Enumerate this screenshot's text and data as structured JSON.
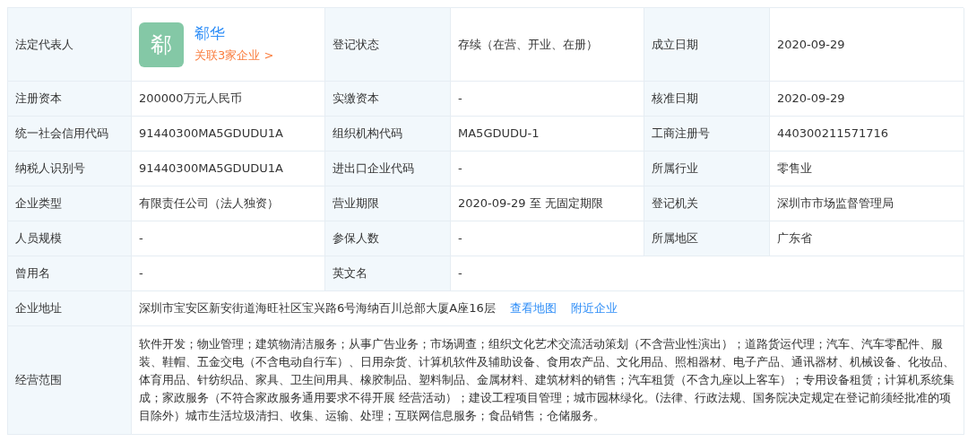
{
  "rows": [
    {
      "kind": "pairs",
      "items": [
        {
          "kind": "person",
          "label": "法定代表人",
          "avatar": "郗",
          "name": "郗华",
          "link": "关联3家企业 >"
        },
        {
          "kind": "text",
          "label": "登记状态",
          "value": "存续（在营、开业、在册）"
        },
        {
          "kind": "text",
          "label": "成立日期",
          "value": "2020-09-29"
        }
      ]
    },
    {
      "kind": "pairs",
      "items": [
        {
          "kind": "text",
          "label": "注册资本",
          "value": "200000万元人民币"
        },
        {
          "kind": "text",
          "label": "实缴资本",
          "value": "-"
        },
        {
          "kind": "text",
          "label": "核准日期",
          "value": "2020-09-29"
        }
      ]
    },
    {
      "kind": "pairs",
      "items": [
        {
          "kind": "text",
          "label": "统一社会信用代码",
          "value": "91440300MA5GDUDU1A"
        },
        {
          "kind": "text",
          "label": "组织机构代码",
          "value": "MA5GDUDU-1"
        },
        {
          "kind": "text",
          "label": "工商注册号",
          "value": "440300211571716"
        }
      ]
    },
    {
      "kind": "pairs",
      "items": [
        {
          "kind": "text",
          "label": "纳税人识别号",
          "value": "91440300MA5GDUDU1A"
        },
        {
          "kind": "text",
          "label": "进出口企业代码",
          "value": "-"
        },
        {
          "kind": "text",
          "label": "所属行业",
          "value": "零售业"
        }
      ]
    },
    {
      "kind": "pairs",
      "items": [
        {
          "kind": "text",
          "label": "企业类型",
          "value": "有限责任公司（法人独资）"
        },
        {
          "kind": "text",
          "label": "营业期限",
          "value": "2020-09-29 至 无固定期限"
        },
        {
          "kind": "text",
          "label": "登记机关",
          "value": "深圳市市场监督管理局"
        }
      ]
    },
    {
      "kind": "pairs",
      "items": [
        {
          "kind": "text",
          "label": "人员规模",
          "value": "-"
        },
        {
          "kind": "text",
          "label": "参保人数",
          "value": "-"
        },
        {
          "kind": "text",
          "label": "所属地区",
          "value": "广东省"
        }
      ]
    },
    {
      "kind": "pairs",
      "items": [
        {
          "kind": "text",
          "label": "曾用名",
          "value": "-"
        },
        {
          "kind": "text",
          "label": "英文名",
          "value": "-"
        }
      ]
    },
    {
      "kind": "address",
      "label": "企业地址",
      "value": "深圳市宝安区新安街道海旺社区宝兴路6号海纳百川总部大厦A座16层",
      "links": [
        "查看地图",
        "附近企业"
      ]
    },
    {
      "kind": "scope",
      "label": "经营范围",
      "value": "软件开发；物业管理；建筑物清洁服务；从事广告业务；市场调查；组织文化艺术交流活动策划（不含营业性演出）；道路货运代理；汽车、汽车零配件、服装、鞋帽、五金交电（不含电动自行车）、日用杂货、计算机软件及辅助设备、食用农产品、文化用品、照相器材、电子产品、通讯器材、机械设备、化妆品、体育用品、针纺织品、家具、卫生间用具、橡胶制品、塑料制品、金属材料、建筑材料的销售；汽车租赁（不含九座以上客车）；专用设备租赁；计算机系统集成；家政服务（不符合家政服务通用要求不得开展 经营活动）；建设工程项目管理；城市园林绿化。(法律、行政法规、国务院决定规定在登记前须经批准的项目除外）城市生活垃圾清扫、收集、运输、处理；互联网信息服务；食品销售；仓储服务。"
    }
  ]
}
